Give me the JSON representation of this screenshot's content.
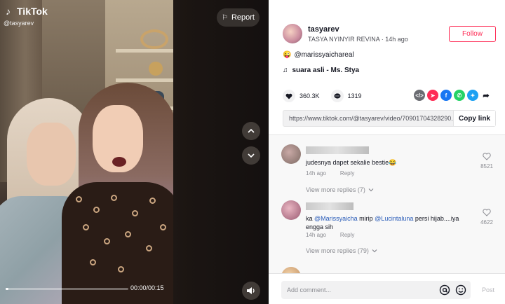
{
  "video": {
    "brand": "TikTok",
    "handle": "@tasyarev",
    "report_label": "Report",
    "time": "00:00/00:15",
    "progress_fraction": 0.02
  },
  "author": {
    "username": "tasyarev",
    "display_name": "TASYA NYINYIR REVINA",
    "posted": "· 14h ago",
    "follow_label": "Follow"
  },
  "caption": {
    "emoji": "😜",
    "mention": "@marissyaichareal"
  },
  "music": {
    "label": "suara asli - Ms. Stya"
  },
  "stats": {
    "likes": "360.3K",
    "comments": "1319"
  },
  "share": {
    "icons": [
      "embed-icon",
      "send-icon",
      "facebook-icon",
      "whatsapp-icon",
      "twitter-icon",
      "share-arrow-icon"
    ],
    "colors": [
      "#6b6c72",
      "#fe2c55",
      "#1877f2",
      "#25d366",
      "#1da1f2",
      "#161823"
    ]
  },
  "link": {
    "url": "https://www.tiktok.com/@tasyarev/video/70901704328290...",
    "copy_label": "Copy link"
  },
  "comments": [
    {
      "text": "judesnya dapet sekalie bestie😂",
      "time": "14h ago",
      "reply_label": "Reply",
      "likes": "8521",
      "view_replies": "View more replies (7)"
    },
    {
      "text_pre": "ka ",
      "mention1": "@Marissyaicha",
      "text_mid": " mirip ",
      "mention2": "@Lucintaluna",
      "text_post": " persi hijab....iya engga sih",
      "time": "14h ago",
      "reply_label": "Reply",
      "likes": "4622",
      "view_replies": "View more replies (79)"
    }
  ],
  "comment_bar": {
    "placeholder": "Add comment...",
    "post_label": "Post"
  }
}
